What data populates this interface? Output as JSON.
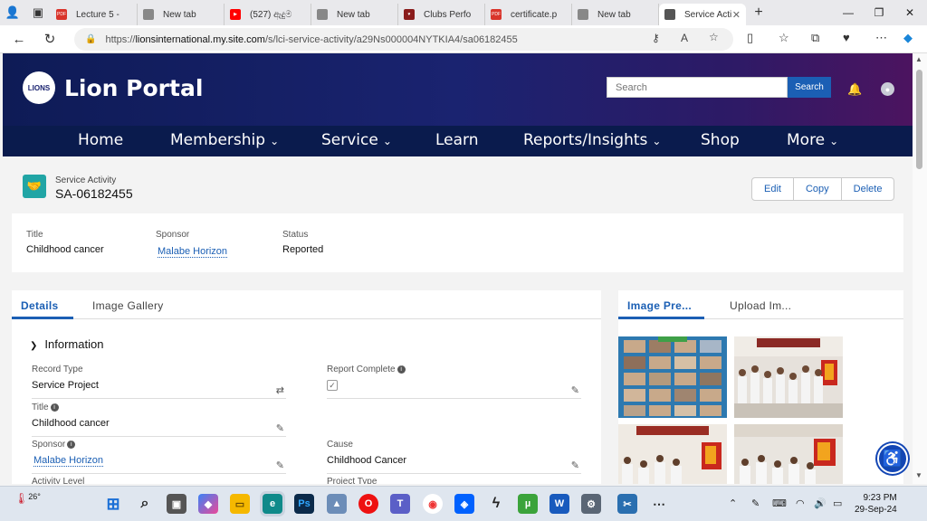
{
  "browser": {
    "tabs": [
      {
        "label": "Lecture 5 -",
        "fav_color": "#d9342b",
        "fav_text": "PDF"
      },
      {
        "label": "New tab",
        "fav_color": "#888888",
        "fav_text": ""
      },
      {
        "label": "(527) ඇදුම",
        "fav_color": "#ff0000",
        "fav_text": "▶"
      },
      {
        "label": "New tab",
        "fav_color": "#888888",
        "fav_text": ""
      },
      {
        "label": "Clubs Perfo",
        "fav_color": "#8a1c1c",
        "fav_text": "♥"
      },
      {
        "label": "certificate.p",
        "fav_color": "#d9342b",
        "fav_text": "PDF"
      },
      {
        "label": "New tab",
        "fav_color": "#888888",
        "fav_text": ""
      },
      {
        "label": "Service Acti",
        "fav_color": "#555555",
        "fav_text": ""
      }
    ],
    "url_prefix": "https://",
    "url_domain": "lionsinternational.my.site.com",
    "url_path": "/s/lci-service-activity/a29Ns000004NYTKIA4/sa06182455"
  },
  "portal": {
    "logo_mark": "LIONS",
    "title": "Lion Portal",
    "search_placeholder": "Search",
    "search_button": "Search",
    "menu": [
      {
        "label": "Home",
        "dropdown": false
      },
      {
        "label": "Membership",
        "dropdown": true
      },
      {
        "label": "Service",
        "dropdown": true
      },
      {
        "label": "Learn",
        "dropdown": false
      },
      {
        "label": "Reports/Insights",
        "dropdown": true
      },
      {
        "label": "Shop",
        "dropdown": false
      },
      {
        "label": "More",
        "dropdown": true
      }
    ]
  },
  "record": {
    "type_label": "Service Activity",
    "name": "SA-06182455",
    "actions": [
      "Edit",
      "Copy",
      "Delete"
    ]
  },
  "highlights": {
    "title_label": "Title",
    "title_value": "Childhood cancer",
    "sponsor_label": "Sponsor",
    "sponsor_value": "Malabe Horizon",
    "status_label": "Status",
    "status_value": "Reported"
  },
  "detail_tabs": [
    "Details",
    "Image Gallery"
  ],
  "section_title": "Information",
  "fields": {
    "record_type_label": "Record Type",
    "record_type_value": "Service Project",
    "report_complete_label": "Report Complete",
    "title_label": "Title",
    "title_value": "Childhood cancer",
    "sponsor_label": "Sponsor",
    "sponsor_value": "Malabe Horizon",
    "cause_label": "Cause",
    "cause_value": "Childhood Cancer",
    "activity_level_label": "Activity Level",
    "project_type_label": "Project Type"
  },
  "side_tabs": [
    "Image Pre...",
    "Upload Im..."
  ],
  "taskbar": {
    "temperature": "26°",
    "time": "9:23 PM",
    "date": "29-Sep-24"
  },
  "colors": {
    "brand_blue": "#1b5fb4",
    "header_nav": "#0a1b4d",
    "record_icon": "#21a5a5"
  }
}
